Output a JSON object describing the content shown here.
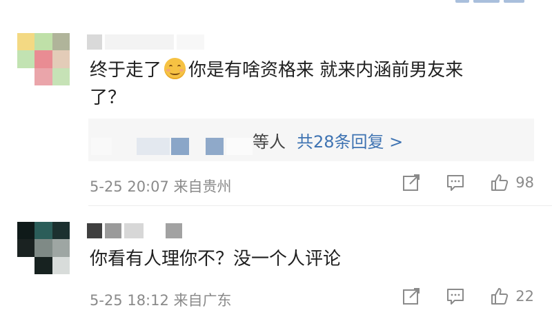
{
  "comments": [
    {
      "text_line1": "终于走了",
      "emoji": "smile-emoji",
      "text_line1b": "你是有啥资格来 就来内涵前男友来",
      "text_line2": "了？",
      "reply_suffix": "等人",
      "reply_link": "共28条回复 >",
      "time": "5-25 20:07 来自贵州",
      "likes": "98"
    },
    {
      "text_line1": "你看有人理你不？没一个人评论",
      "time": "5-25 18:12 来自广东",
      "likes": "22"
    }
  ],
  "icons": [
    "share-icon",
    "comment-icon",
    "like-icon"
  ],
  "colors": {
    "link": "#3e73b2",
    "meta": "#8a8a8a",
    "reply_bg": "#f6f6f6"
  }
}
